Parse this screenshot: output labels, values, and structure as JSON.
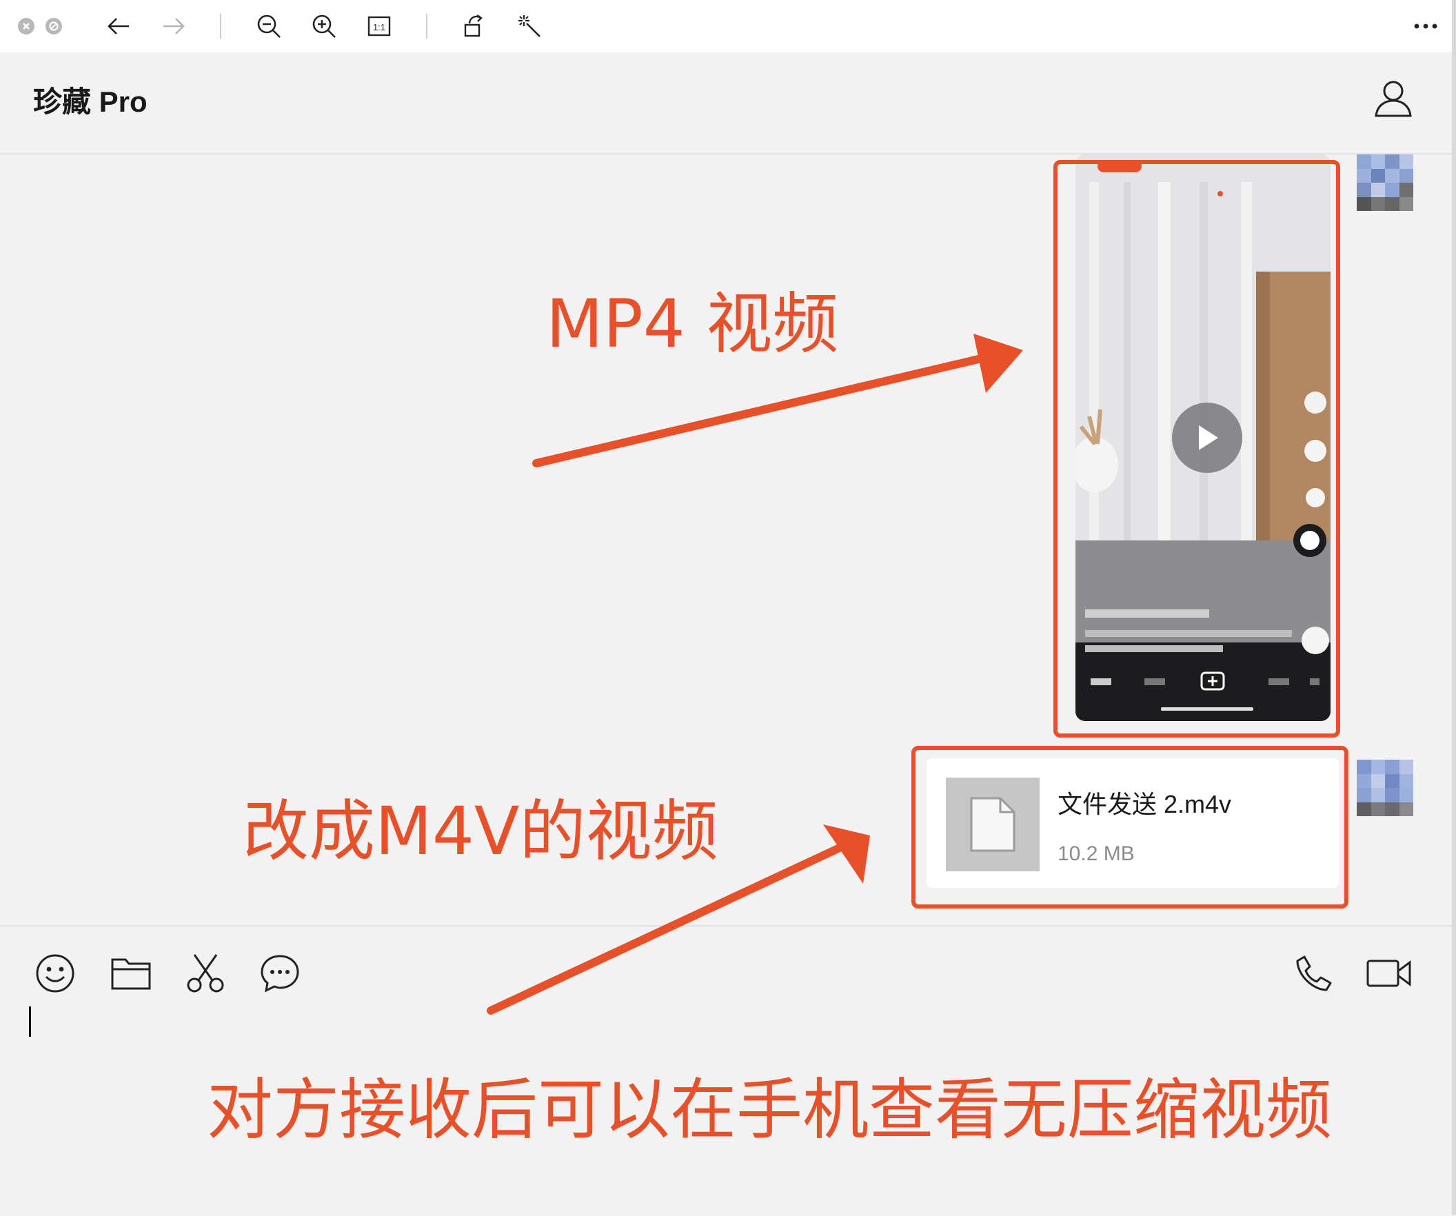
{
  "window": {
    "toolbar": {
      "icons": [
        "close-icon",
        "minimize-icon",
        "back-arrow-icon",
        "forward-arrow-icon",
        "zoom-out-icon",
        "zoom-in-icon",
        "actual-size-icon",
        "rotate-icon",
        "magic-wand-icon",
        "more-icon"
      ],
      "actual_size_label": "1:1"
    }
  },
  "chat": {
    "title": "珍藏 Pro",
    "profile_icon": "user-icon"
  },
  "messages": {
    "video": {
      "icon": "play-icon"
    },
    "file": {
      "name": "文件发送 2.m4v",
      "size": "10.2 MB",
      "icon": "document-icon"
    }
  },
  "annotations": {
    "mp4_label": "MP4 视频",
    "m4v_label": "改成M4V的视频",
    "caption": "对方接收后可以在手机查看无压缩视频",
    "color": "#e8502a"
  },
  "composer": {
    "tools": [
      "emoji-icon",
      "folder-icon",
      "scissors-icon",
      "chat-bubble-icon"
    ],
    "call_tools": [
      "phone-icon",
      "video-camera-icon"
    ]
  }
}
